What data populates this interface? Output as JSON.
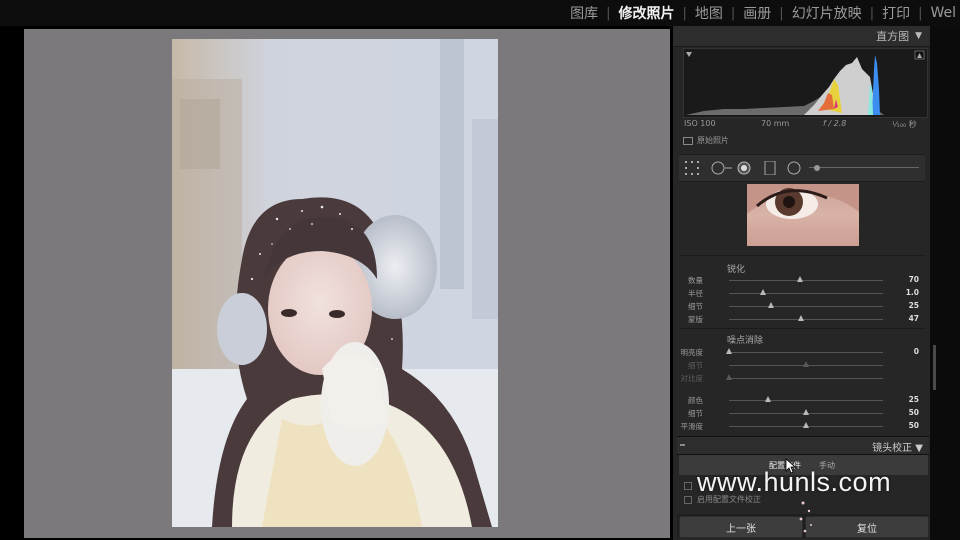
{
  "nav": {
    "modules": [
      {
        "label": "图库",
        "active": false
      },
      {
        "label": "修改照片",
        "active": true
      },
      {
        "label": "地图",
        "active": false
      },
      {
        "label": "画册",
        "active": false
      },
      {
        "label": "幻灯片放映",
        "active": false
      },
      {
        "label": "打印",
        "active": false
      },
      {
        "label": "Web",
        "active": false
      }
    ],
    "visible_text": [
      "图库",
      "修改照片",
      "地图",
      "画册",
      "幻灯片放映",
      "打印",
      "Wel"
    ]
  },
  "histogram": {
    "title": "直方图",
    "iso": "ISO 100",
    "focal": "70 mm",
    "aperture": "f / 2.8",
    "shutter": "¹⁄₁₀₀ 秒",
    "original_label": "原始照片"
  },
  "detail": {
    "sharpen_title": "锐化",
    "sharpen": [
      {
        "label": "数量",
        "value": "70",
        "pos": 0.46
      },
      {
        "label": "半径",
        "value": "1.0",
        "pos": 0.22
      },
      {
        "label": "细节",
        "value": "25",
        "pos": 0.27
      },
      {
        "label": "蒙版",
        "value": "47",
        "pos": 0.47
      }
    ],
    "nr_title": "噪点消除",
    "noise": [
      {
        "label": "明亮度",
        "value": "0",
        "pos": 0.0,
        "dim": false
      },
      {
        "label": "细节",
        "value": "",
        "pos": 0.5,
        "dim": true
      },
      {
        "label": "对比度",
        "value": "",
        "pos": 0.0,
        "dim": true
      },
      {
        "label": "颜色",
        "value": "25",
        "pos": 0.25,
        "dim": false
      },
      {
        "label": "细节",
        "value": "50",
        "pos": 0.5,
        "dim": false
      },
      {
        "label": "平滑度",
        "value": "50",
        "pos": 0.5,
        "dim": false
      }
    ]
  },
  "lens": {
    "title": "镜头校正",
    "tab_profile": "配置文件",
    "tab_manual": "手动",
    "option_enable_profile": "启用配置文件校正"
  },
  "buttons": {
    "previous": "上一张",
    "reset": "复位"
  },
  "watermark": "www.hunls.com"
}
